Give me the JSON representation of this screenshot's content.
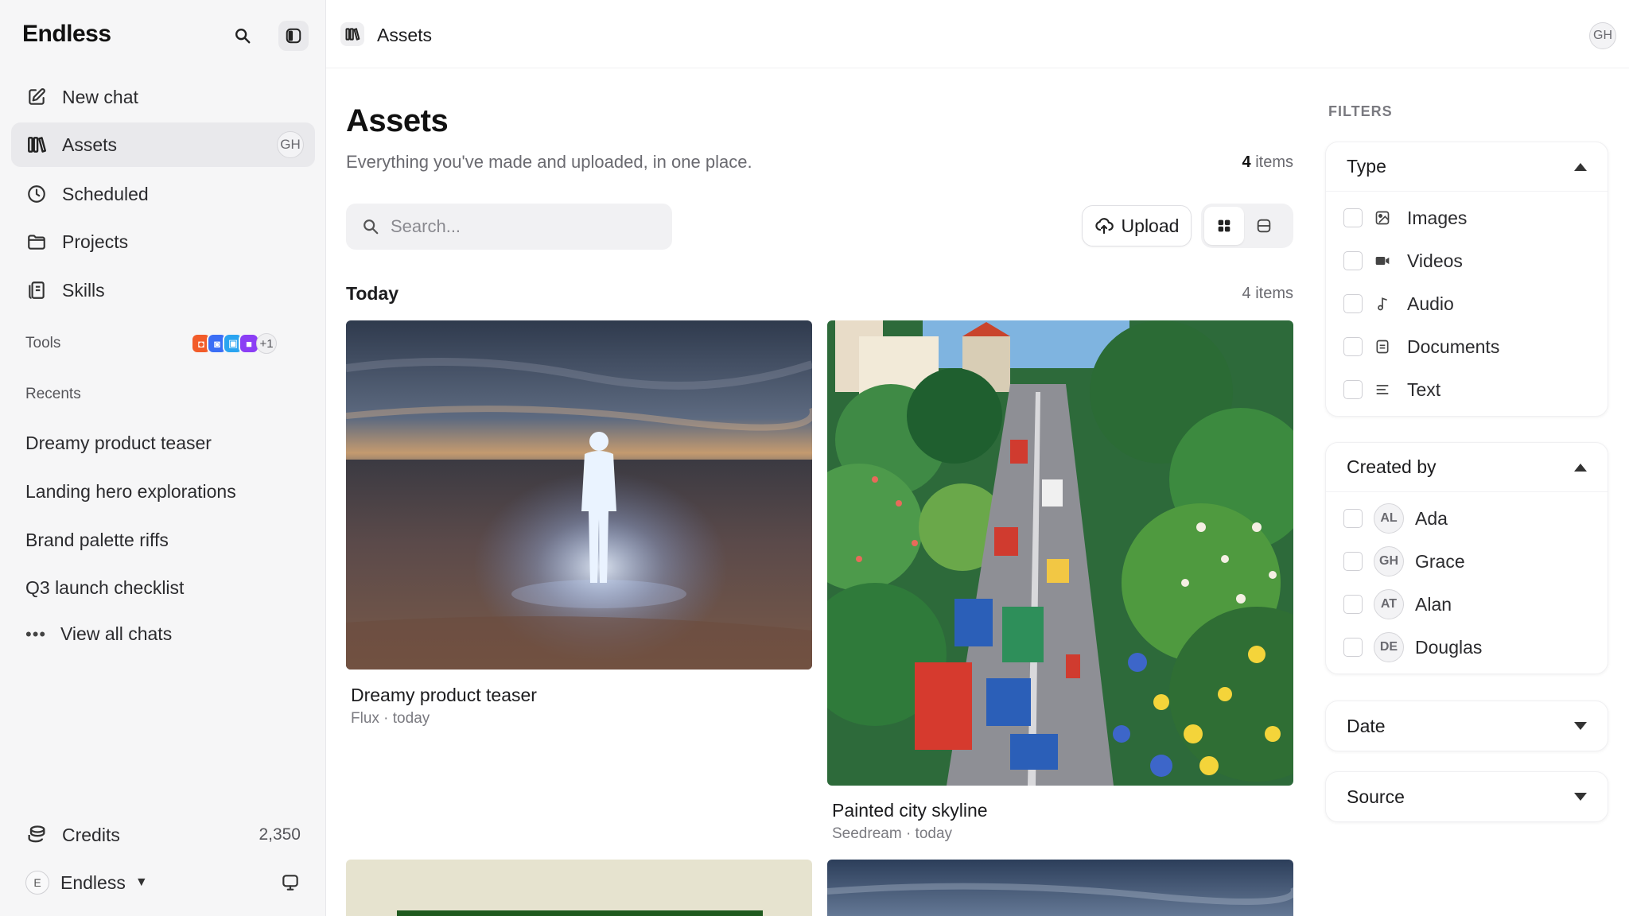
{
  "app": {
    "name": "Endless"
  },
  "sidebar": {
    "nav": [
      {
        "label": "New chat",
        "icon": "compose-icon"
      },
      {
        "label": "Assets",
        "icon": "assets-icon",
        "badge": "GH",
        "active": true
      },
      {
        "label": "Scheduled",
        "icon": "clock-icon"
      },
      {
        "label": "Projects",
        "icon": "folder-icon"
      },
      {
        "label": "Skills",
        "icon": "skills-icon"
      }
    ],
    "tools_label": "Tools",
    "tools_more": "+1",
    "tool_colors": [
      "#f25c2a",
      "#3b6ef5",
      "#2aa4f0",
      "#8b3ef5"
    ],
    "recents_label": "Recents",
    "recents": [
      "Dreamy product teaser",
      "Landing hero explorations",
      "Brand palette riffs",
      "Q3 launch checklist"
    ],
    "view_all": "View all chats",
    "credits_label": "Credits",
    "credits_value": "2,350",
    "workspace_initial": "E",
    "workspace_name": "Endless"
  },
  "topbar": {
    "breadcrumb": "Assets",
    "user_initials": "GH"
  },
  "main": {
    "title": "Assets",
    "subtitle": "Everything you've made and uploaded, in one place.",
    "count_number": "4",
    "count_suffix": " items",
    "search_placeholder": "Search...",
    "upload_label": "Upload",
    "groups": [
      {
        "label": "Today",
        "count": "4 items",
        "cards": [
          {
            "title": "Dreamy product teaser",
            "model": "Flux",
            "when": "today",
            "meta": "Flux · today"
          },
          {
            "title": "Painted city skyline",
            "model": "Seedream",
            "when": "today",
            "meta": "Seedream · today"
          }
        ]
      }
    ]
  },
  "filters": {
    "label": "FILTERS",
    "type": {
      "title": "Type",
      "options": [
        {
          "label": "Images",
          "icon": "image-icon"
        },
        {
          "label": "Videos",
          "icon": "video-icon"
        },
        {
          "label": "Audio",
          "icon": "music-note-icon"
        },
        {
          "label": "Documents",
          "icon": "document-icon"
        },
        {
          "label": "Text",
          "icon": "text-lines-icon"
        }
      ]
    },
    "created_by": {
      "title": "Created by",
      "people": [
        {
          "initials": "AL",
          "name": "Ada"
        },
        {
          "initials": "GH",
          "name": "Grace"
        },
        {
          "initials": "AT",
          "name": "Alan"
        },
        {
          "initials": "DE",
          "name": "Douglas"
        }
      ]
    },
    "date": {
      "title": "Date"
    },
    "source": {
      "title": "Source"
    }
  }
}
